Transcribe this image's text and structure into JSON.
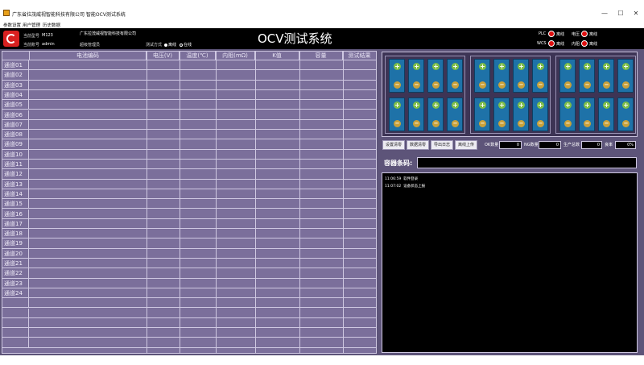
{
  "window": {
    "title": "广东省拉茂威视智能科技有限公司 智能OCV测试系统",
    "minimize": "—",
    "maximize": "☐",
    "close": "✕"
  },
  "menu": [
    "参数设置",
    "用户管理",
    "历史数据"
  ],
  "header": {
    "work_order_label": "当前型号",
    "work_order_value": "M123",
    "operator_label": "当前账号",
    "operator_value": "admin",
    "company": "广东拉茂威视智能科技有限公司",
    "super_admin": "超级管理员",
    "test_mode_label": "测试方式",
    "mode_offline": "离线",
    "mode_online": "在线",
    "app_title": "OCV测试系统",
    "indicators": [
      {
        "label": "PLC",
        "state": "离线"
      },
      {
        "label": "电压",
        "state": "离线"
      },
      {
        "label": "WCS",
        "state": "离线"
      },
      {
        "label": "内阻",
        "state": "离线"
      }
    ]
  },
  "table": {
    "columns": [
      "",
      "电池编码",
      "电压(V)",
      "温度(℃)",
      "内阻(mΩ)",
      "K值",
      "容量",
      "测试结果"
    ],
    "rows": [
      "通道01",
      "通道02",
      "通道03",
      "通道04",
      "通道05",
      "通道06",
      "通道07",
      "通道08",
      "通道09",
      "通道10",
      "通道11",
      "通道12",
      "通道13",
      "通道14",
      "通道15",
      "通道16",
      "通道17",
      "通道18",
      "通道19",
      "通道20",
      "通道21",
      "通道22",
      "通道23",
      "通道24"
    ]
  },
  "controls": {
    "buttons": [
      "设置清零",
      "数据清零",
      "导出日志",
      "离线上传"
    ],
    "ok_label": "OK数量",
    "ok_value": "0",
    "ng_label": "NG数量",
    "ng_value": "0",
    "total_label": "生产总数",
    "total_value": "0",
    "rate_label": "良率",
    "rate_value": "0%"
  },
  "barcode": {
    "label": "容器条码:",
    "value": ""
  },
  "log": [
    {
      "time": "11:06:59",
      "text": "软件登录"
    },
    {
      "time": "11:07:02",
      "text": "设备状态上报"
    }
  ],
  "colors": {
    "panel_bg": "#5d5479",
    "table_bg": "#7b6f9b",
    "cell_blue": "#1e72a8",
    "indicator_red": "#e01010"
  }
}
